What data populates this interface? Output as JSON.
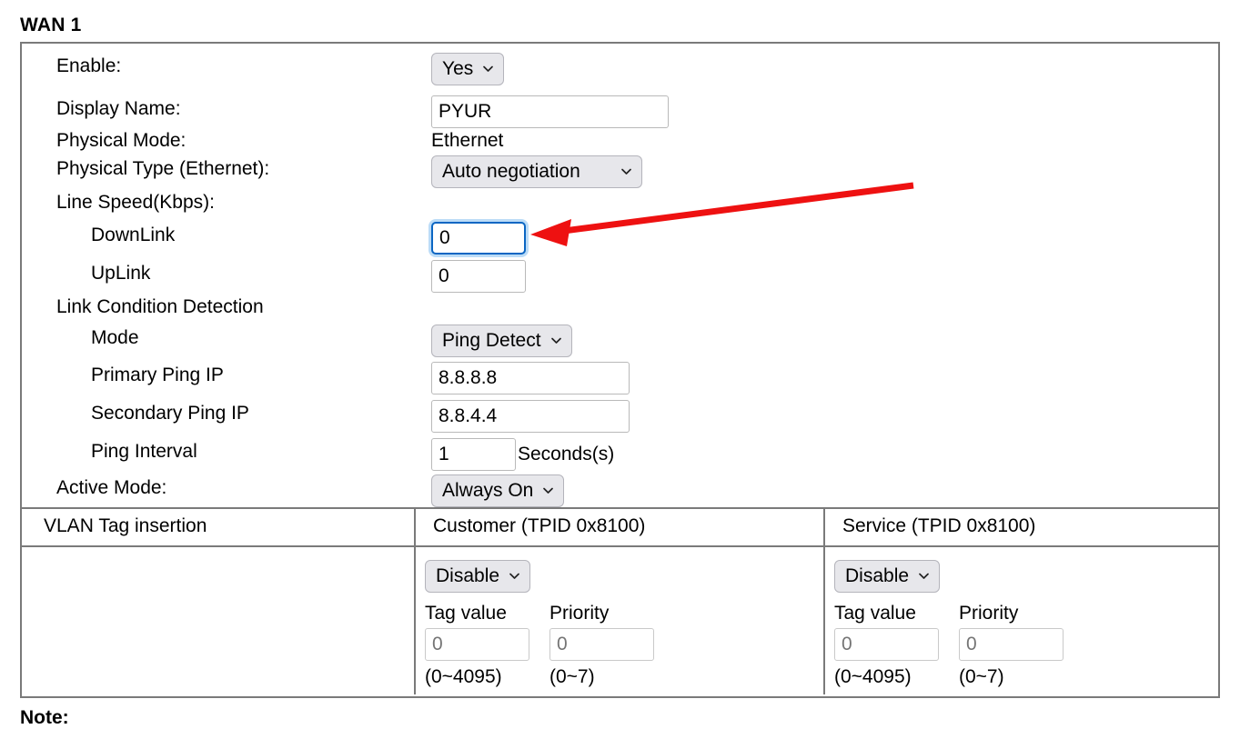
{
  "page": {
    "title": "WAN 1",
    "note_label": "Note:"
  },
  "settings": {
    "rows": [
      {
        "label": "Enable:",
        "control": "select",
        "value": "Yes",
        "name": "enable"
      },
      {
        "label": "Display Name:",
        "control": "text",
        "value": "PYUR",
        "name": "display-name"
      },
      {
        "label": "Physical Mode:",
        "control": "static",
        "value": "Ethernet",
        "name": "physical-mode"
      },
      {
        "label": "Physical Type (Ethernet):",
        "control": "select",
        "value": "Auto negotiation",
        "name": "physical-type"
      },
      {
        "label": "Line Speed(Kbps):",
        "control": "none",
        "value": "",
        "name": "line-speed"
      },
      {
        "label": "DownLink",
        "control": "text",
        "value": "0",
        "name": "downlink",
        "indent": true,
        "focused": true
      },
      {
        "label": "UpLink",
        "control": "text",
        "value": "0",
        "name": "uplink",
        "indent": true
      },
      {
        "label": "Link Condition Detection",
        "control": "none",
        "value": "",
        "name": "link-condition-detection"
      },
      {
        "label": "Mode",
        "control": "select",
        "value": "Ping Detect",
        "name": "mode",
        "indent": true
      },
      {
        "label": "Primary Ping IP",
        "control": "text",
        "value": "8.8.8.8",
        "name": "primary-ping-ip",
        "indent": true
      },
      {
        "label": "Secondary Ping IP",
        "control": "text",
        "value": "8.8.4.4",
        "name": "secondary-ping-ip",
        "indent": true
      },
      {
        "label": "Ping Interval",
        "control": "text",
        "value": "1",
        "suffix": "Seconds(s)",
        "name": "ping-interval",
        "indent": true
      },
      {
        "label": "Active Mode:",
        "control": "select",
        "value": "Always On",
        "name": "active-mode"
      }
    ]
  },
  "vlan": {
    "row_label": "VLAN Tag insertion",
    "customer": {
      "header": "Customer (TPID 0x8100)",
      "mode": "Disable",
      "tag_value_label": "Tag value",
      "tag_value": "0",
      "tag_value_range": "(0~4095)",
      "priority_label": "Priority",
      "priority": "0",
      "priority_range": "(0~7)"
    },
    "service": {
      "header": "Service (TPID 0x8100)",
      "mode": "Disable",
      "tag_value_label": "Tag value",
      "tag_value": "0",
      "tag_value_range": "(0~4095)",
      "priority_label": "Priority",
      "priority": "0",
      "priority_range": "(0~7)"
    }
  },
  "annotation": {
    "arrow_color": "#ee1111",
    "points_to": "downlink-input"
  },
  "colors": {
    "focus_border": "#0b66c3",
    "focus_ring": "#bcdcf7",
    "select_bg": "#e7e7eb",
    "table_border": "#7a7a7a",
    "arrow": "#ee1111"
  }
}
